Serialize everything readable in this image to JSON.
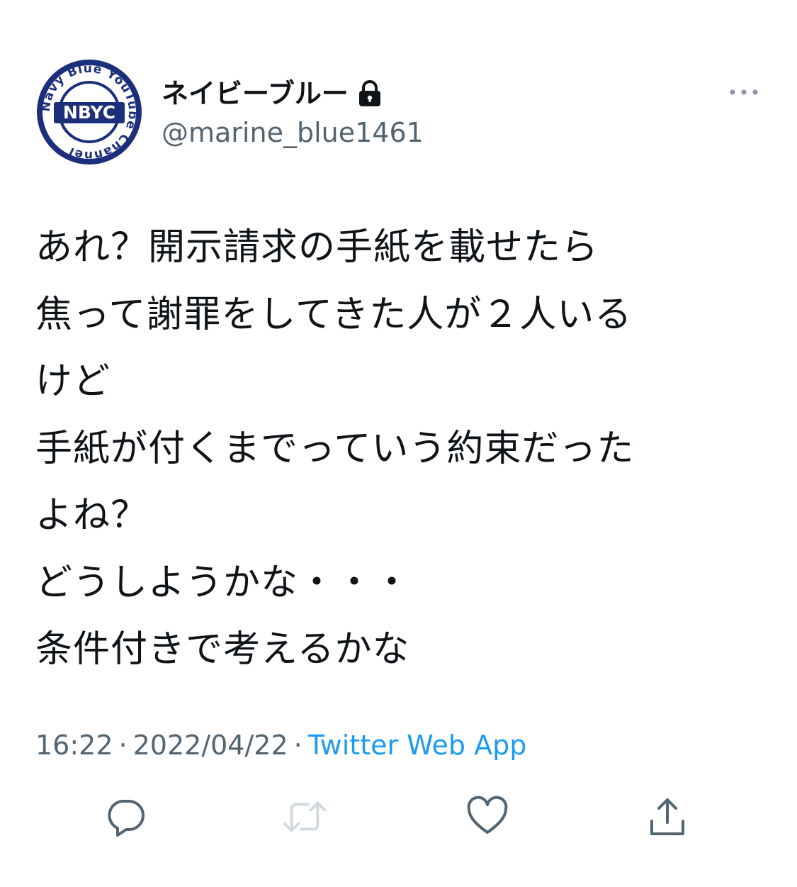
{
  "user": {
    "display_name": "ネイビーブルー",
    "handle": "@marine_blue1461",
    "protected_icon": "lock-icon",
    "avatar": {
      "ring_text": "Navy Blue YouTube Channel",
      "center_text": "NBYC",
      "color": "#1c2f7a"
    }
  },
  "tweet": {
    "lines": [
      "あれ？開示請求の手紙を載せたら",
      "焦って謝罪をしてきた人が２人いる",
      "けど",
      "手紙が付くまでっていう約束だった",
      "よね？",
      "どうしようかな・・・",
      "条件付きで考えるかな"
    ],
    "time": "16:22",
    "date": "2022/04/22",
    "separator": "·",
    "source": "Twitter Web App"
  },
  "actions": [
    {
      "name": "reply",
      "icon": "reply-icon"
    },
    {
      "name": "retweet",
      "icon": "retweet-icon"
    },
    {
      "name": "like",
      "icon": "heart-icon"
    },
    {
      "name": "share",
      "icon": "share-icon"
    }
  ],
  "colors": {
    "text_primary": "#0f1419",
    "text_secondary": "#536471",
    "link": "#1d9bf0",
    "icon_gray": "#536471",
    "disabled_gray": "#cfd9de"
  }
}
